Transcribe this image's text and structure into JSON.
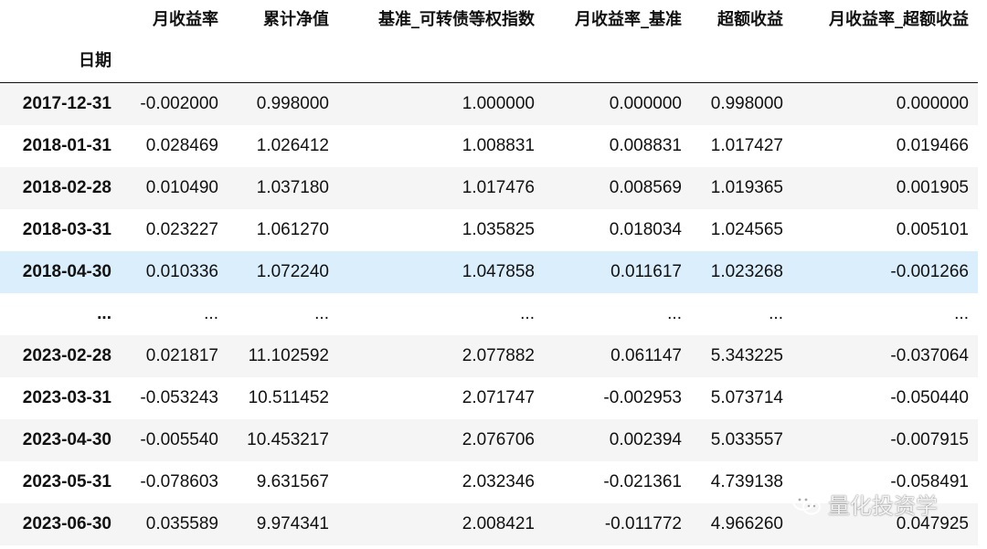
{
  "columns": [
    "月收益率",
    "累计净值",
    "基准_可转债等权指数",
    "月收益率_基准",
    "超额收益",
    "月收益率_超额收益"
  ],
  "index_name": "日期",
  "rows": [
    {
      "date": "2017-12-31",
      "values": [
        "-0.002000",
        "0.998000",
        "1.000000",
        "0.000000",
        "0.998000",
        "0.000000"
      ]
    },
    {
      "date": "2018-01-31",
      "values": [
        "0.028469",
        "1.026412",
        "1.008831",
        "0.008831",
        "1.017427",
        "0.019466"
      ]
    },
    {
      "date": "2018-02-28",
      "values": [
        "0.010490",
        "1.037180",
        "1.017476",
        "0.008569",
        "1.019365",
        "0.001905"
      ]
    },
    {
      "date": "2018-03-31",
      "values": [
        "0.023227",
        "1.061270",
        "1.035825",
        "0.018034",
        "1.024565",
        "0.005101"
      ]
    },
    {
      "date": "2018-04-30",
      "values": [
        "0.010336",
        "1.072240",
        "1.047858",
        "0.011617",
        "1.023268",
        "-0.001266"
      ]
    },
    {
      "date": "...",
      "values": [
        "...",
        "...",
        "...",
        "...",
        "...",
        "..."
      ]
    },
    {
      "date": "2023-02-28",
      "values": [
        "0.021817",
        "11.102592",
        "2.077882",
        "0.061147",
        "5.343225",
        "-0.037064"
      ]
    },
    {
      "date": "2023-03-31",
      "values": [
        "-0.053243",
        "10.511452",
        "2.071747",
        "-0.002953",
        "5.073714",
        "-0.050440"
      ]
    },
    {
      "date": "2023-04-30",
      "values": [
        "-0.005540",
        "10.453217",
        "2.076706",
        "0.002394",
        "5.033557",
        "-0.007915"
      ]
    },
    {
      "date": "2023-05-31",
      "values": [
        "-0.078603",
        "9.631567",
        "2.032346",
        "-0.021361",
        "4.739138",
        "-0.058491"
      ]
    },
    {
      "date": "2023-06-30",
      "values": [
        "0.035589",
        "9.974341",
        "2.008421",
        "-0.011772",
        "4.966260",
        "0.047925"
      ]
    }
  ],
  "highlighted_row": 4,
  "watermark": {
    "text": "量化投资学",
    "icon": "wechat-icon"
  }
}
